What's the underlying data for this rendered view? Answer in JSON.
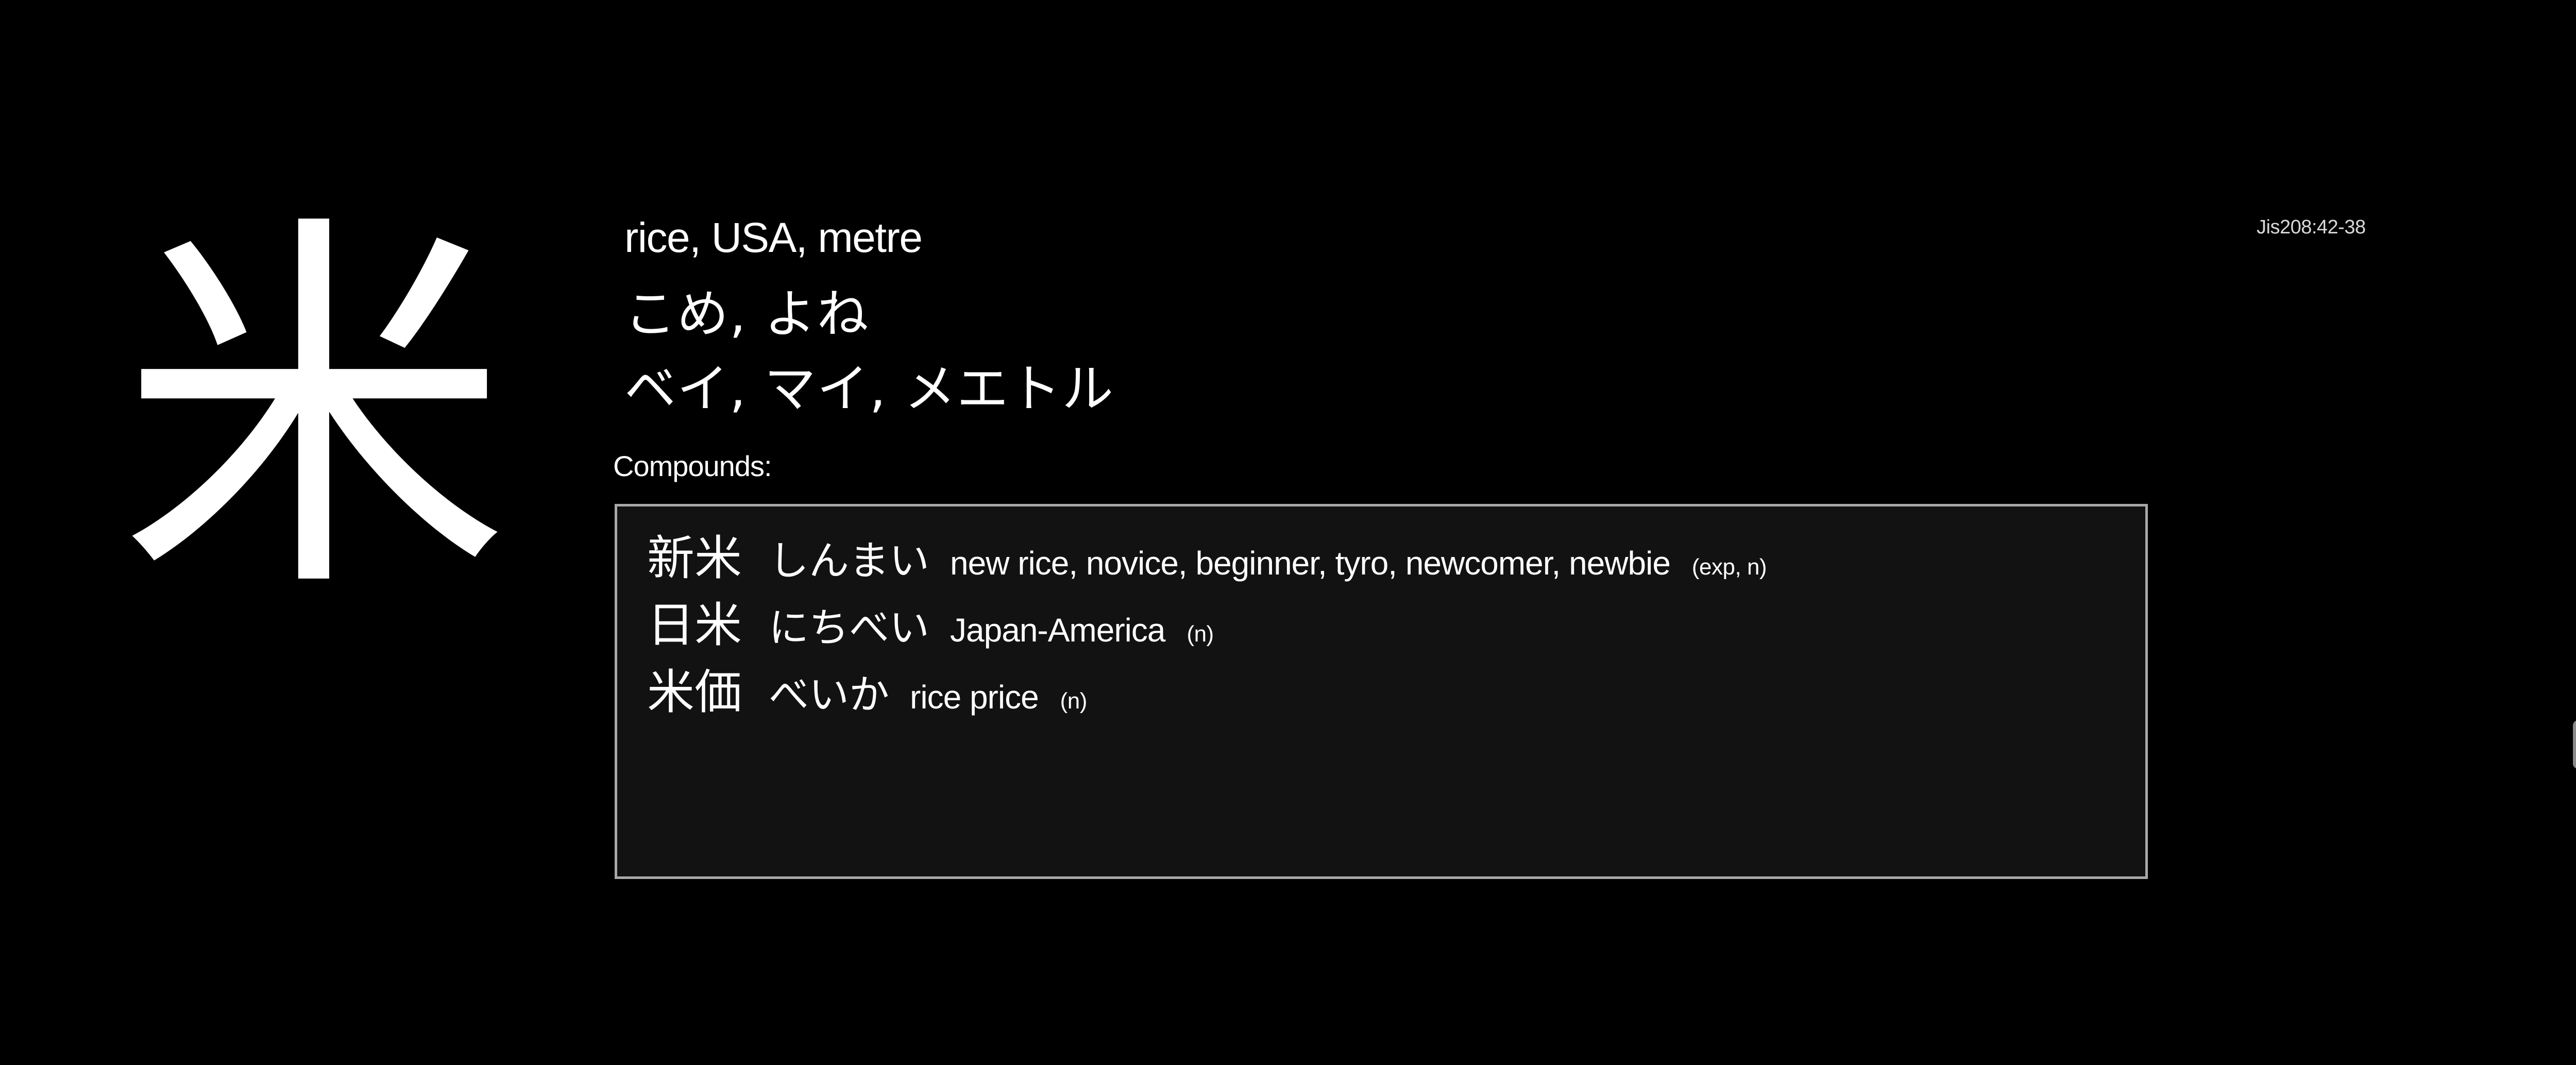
{
  "kanji": "米",
  "jis_code": "Jis208:42-38",
  "meanings": "rice, USA, metre",
  "kun_readings": "こめ, よね",
  "on_readings": "ベイ, マイ, メエトル",
  "compounds_label": "Compounds:",
  "compounds": [
    {
      "word": "新米",
      "reading": "しんまい",
      "gloss": "new rice, novice, beginner, tyro, newcomer, newbie",
      "pos": "(exp, n)"
    },
    {
      "word": "日米",
      "reading": "にちべい",
      "gloss": "Japan-America",
      "pos": "(n)"
    },
    {
      "word": "米価",
      "reading": "べいか",
      "gloss": "rice price",
      "pos": "(n)"
    }
  ],
  "colors": {
    "background": "#000000",
    "text": "#ffffff",
    "box_background": "#121212",
    "box_border": "#a8a8a8"
  }
}
